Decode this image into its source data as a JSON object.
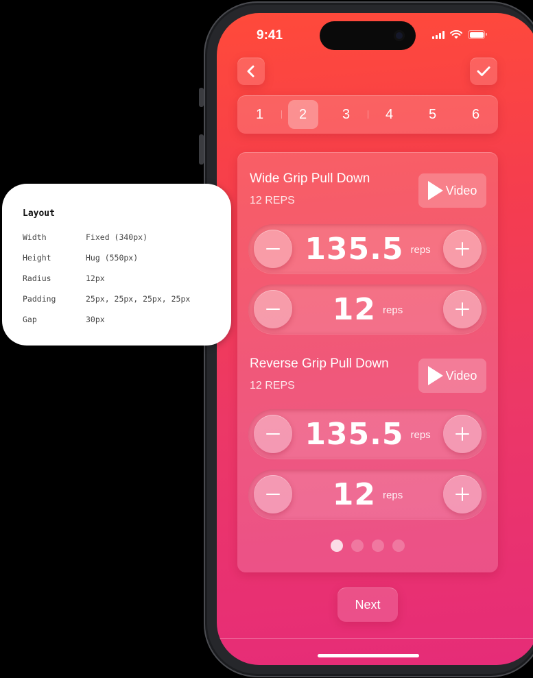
{
  "status_bar": {
    "time": "9:41"
  },
  "header": {
    "back_icon": "chevron-left-icon",
    "confirm_icon": "checkmark-icon"
  },
  "steps": {
    "items": [
      "1",
      "2",
      "3",
      "4",
      "5",
      "6"
    ],
    "active": "2"
  },
  "exercises": [
    {
      "title": "Wide Grip Pull Down",
      "subtitle": "12 REPS",
      "video_label": "Video",
      "weight": {
        "value": "135.5",
        "unit": "reps"
      },
      "reps": {
        "value": "12",
        "unit": "reps"
      }
    },
    {
      "title": "Reverse Grip Pull Down",
      "subtitle": "12 REPS",
      "video_label": "Video",
      "weight": {
        "value": "135.5",
        "unit": "reps"
      },
      "reps": {
        "value": "12",
        "unit": "reps"
      }
    }
  ],
  "pagination": {
    "count": 4,
    "active": 1
  },
  "footer": {
    "next_label": "Next"
  },
  "layout_panel": {
    "title": "Layout",
    "rows": [
      {
        "key": "Width",
        "value": "Fixed (340px)"
      },
      {
        "key": "Height",
        "value": "Hug (550px)"
      },
      {
        "key": "Radius",
        "value": "12px"
      },
      {
        "key": "Padding",
        "value": "25px, 25px, 25px, 25px"
      },
      {
        "key": "Gap",
        "value": "30px"
      }
    ]
  },
  "colors": {
    "gradient_top": "#ff4a3a",
    "gradient_bottom": "#e62c78",
    "accent": "#ffffff"
  }
}
